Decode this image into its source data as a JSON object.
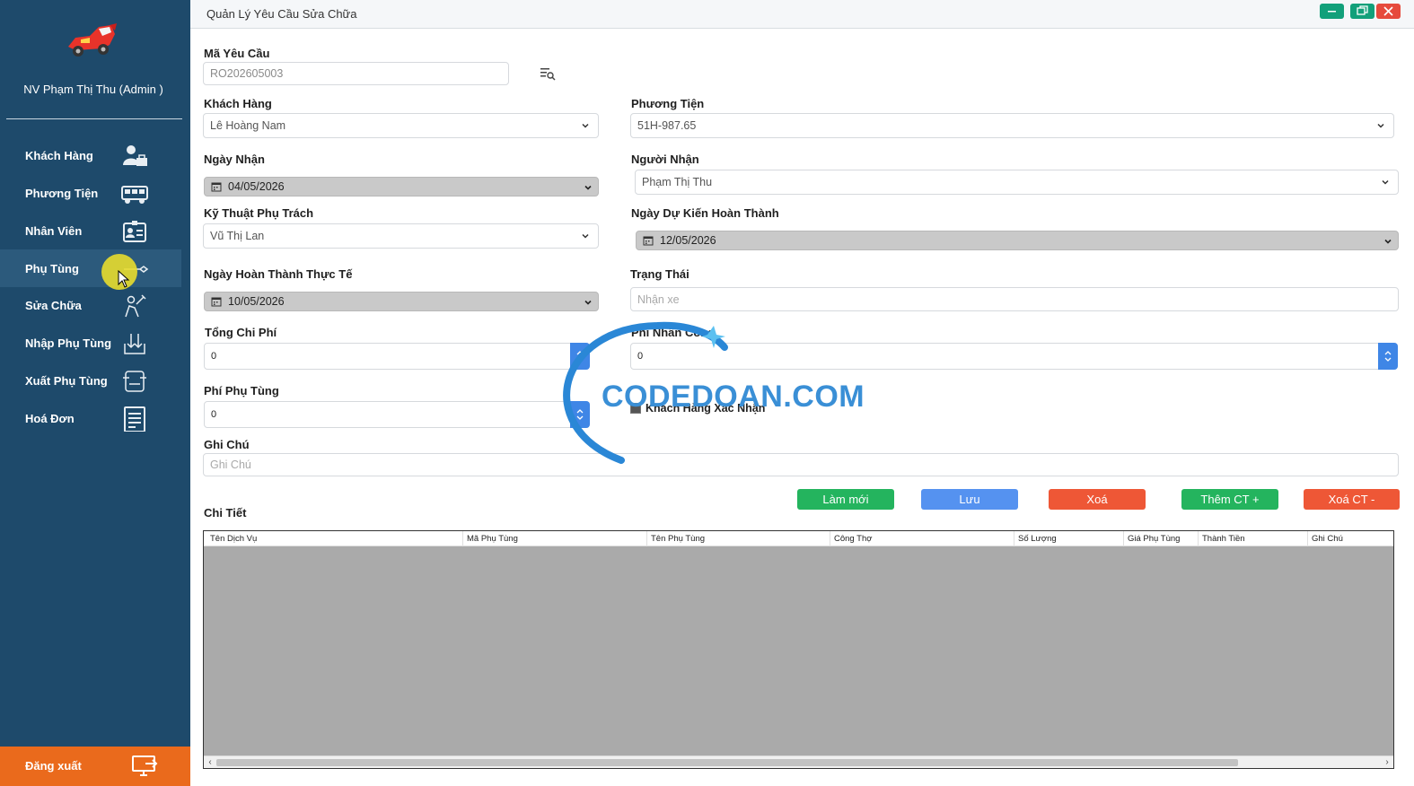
{
  "window": {
    "title": "Quản Lý Yêu Cầu Sửa Chữa",
    "minimize_icon": "minimize-icon",
    "maximize_icon": "restore-icon",
    "close_icon": "close-icon"
  },
  "sidebar": {
    "user": "NV Phạm Thị Thu (Admin )",
    "items": [
      {
        "label": "Khách Hàng",
        "icon": "customer-icon"
      },
      {
        "label": "Phương Tiện",
        "icon": "vehicle-icon"
      },
      {
        "label": "Nhân Viên",
        "icon": "employee-card-icon"
      },
      {
        "label": "Phụ Tùng",
        "icon": "spare-part-icon"
      },
      {
        "label": "Sửa Chữa",
        "icon": "repair-icon"
      },
      {
        "label": "Nhập Phụ Tùng",
        "icon": "import-icon"
      },
      {
        "label": "Xuất Phụ Tùng",
        "icon": "export-icon"
      },
      {
        "label": "Hoá Đơn",
        "icon": "invoice-icon"
      }
    ],
    "active_index": 3,
    "logout_label": "Đăng xuất"
  },
  "form": {
    "request_code": {
      "label": "Mã Yêu Cầu",
      "value": "RO202605003"
    },
    "customer": {
      "label": "Khách Hàng",
      "value": "Lê Hoàng Nam"
    },
    "vehicle": {
      "label": "Phương Tiện",
      "value": "51H-987.65"
    },
    "received_date": {
      "label": "Ngày Nhận",
      "value": "04/05/2026"
    },
    "receiver": {
      "label": "Người Nhận",
      "value": "Phạm Thị Thu"
    },
    "technician": {
      "label": "Kỹ Thuật Phụ Trách",
      "value": "Vũ Thị Lan"
    },
    "expected_date": {
      "label": "Ngày Dự Kiến Hoàn Thành",
      "value": "12/05/2026"
    },
    "actual_date": {
      "label": "Ngày Hoàn Thành Thực Tế",
      "value": "10/05/2026"
    },
    "status": {
      "label": "Trạng Thái",
      "placeholder": "Nhận xe"
    },
    "total_cost": {
      "label": "Tổng Chi Phí",
      "value": "0"
    },
    "labor_cost": {
      "label": "Phí Nhân Công",
      "value": "0"
    },
    "parts_cost": {
      "label": "Phí Phụ Tùng",
      "value": "0"
    },
    "customer_confirm": {
      "label": "Khách Hàng Xác Nhận",
      "checked": false
    },
    "note": {
      "label": "Ghi Chú",
      "placeholder": "Ghi Chú"
    }
  },
  "actions": {
    "refresh": "Làm mới",
    "save": "Lưu",
    "delete": "Xoá",
    "add_detail": "Thêm CT +",
    "delete_detail": "Xoá CT -"
  },
  "details": {
    "title": "Chi Tiết",
    "columns": [
      "Tên Dịch Vụ",
      "Mã Phụ Tùng",
      "Tên Phụ Tùng",
      "Công Thợ",
      "Số Lượng",
      "Giá Phụ Tùng",
      "Thành Tiền",
      "Ghi Chú"
    ],
    "rows": []
  },
  "watermark": {
    "text": "CODEDOAN.COM"
  },
  "colors": {
    "sidebar_bg": "#1e4a6b",
    "logout_bg": "#ea6a1c",
    "green": "#24b45e",
    "blue": "#5592f0",
    "red": "#ee5736"
  }
}
